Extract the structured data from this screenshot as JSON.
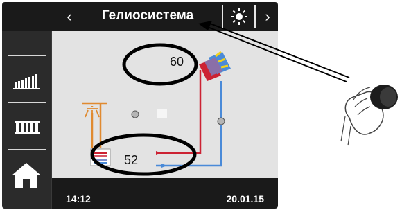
{
  "header": {
    "title": "Гелиосистема",
    "prev_icon": "chevron-left-icon",
    "next_icon": "chevron-right-icon",
    "sun_icon": "sun-icon"
  },
  "sidebar": {
    "items": [
      {
        "icon": "radiator-icon"
      },
      {
        "icon": "radiator-small-icon"
      },
      {
        "icon": "home-icon"
      }
    ]
  },
  "diagram": {
    "collector_temp": "60",
    "tank_temp": "52",
    "colors": {
      "hot": "#cc2233",
      "cold": "#4a8ad8",
      "annotation": "#000000"
    }
  },
  "footer": {
    "time": "14:12",
    "date": "20.01.15"
  }
}
